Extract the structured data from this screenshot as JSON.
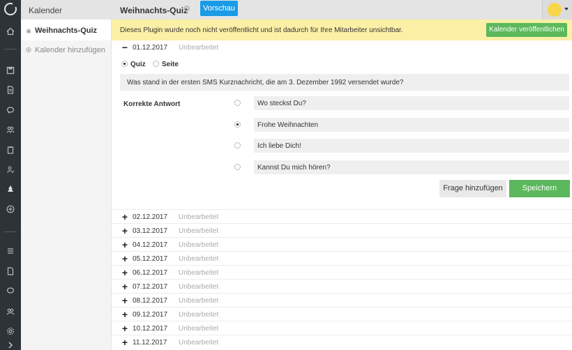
{
  "rail": {
    "icons": [
      "home-icon",
      "save-icon",
      "document-icon",
      "chat-icon",
      "group-icon",
      "clipboard-icon",
      "users-edit-icon",
      "tree-icon",
      "plus-circle-icon",
      "menu-icon",
      "page-icon",
      "comments-icon",
      "team-icon",
      "settings-icon",
      "expand-icon"
    ]
  },
  "sidebar": {
    "header": "Kalender",
    "items": [
      {
        "label": "Weihnachts-Quiz",
        "icon": "lock-icon"
      },
      {
        "label": "Kalender hinzufügen",
        "icon": "add-circle-icon"
      }
    ]
  },
  "topbar": {
    "title": "Weihnachts-Quiz",
    "preview_label": "Vorschau"
  },
  "notice": {
    "message": "Dieses Plugin wurde noch nicht veröffentlicht und ist dadurch für Ihre Mitarbeiter unsichtbar.",
    "publish_label": "Kalender veröffentlichen"
  },
  "open_day": {
    "sign": "−",
    "date": "01.12.2017",
    "status": "Unbearbeitet",
    "type_options": [
      "Quiz",
      "Seite"
    ],
    "selected_type": "Quiz",
    "question": "Was stand in der ersten SMS Kurznachricht, die am 3. Dezember 1992 versendet wurde?",
    "answers_label": "Korrekte Antwort",
    "answers": [
      "Wo steckst Du?",
      "Frohe Weihnachten",
      "Ich liebe Dich!",
      "Kannst Du mich hören?"
    ],
    "correct_index": 1,
    "add_question_label": "Frage hinzufügen",
    "save_label": "Speichern"
  },
  "days": [
    {
      "sign": "+",
      "date": "02.12.2017",
      "status": "Unbearbeitet"
    },
    {
      "sign": "+",
      "date": "03.12.2017",
      "status": "Unbearbeitet"
    },
    {
      "sign": "+",
      "date": "04.12.2017",
      "status": "Unbearbeitet"
    },
    {
      "sign": "+",
      "date": "05.12.2017",
      "status": "Unbearbeitet"
    },
    {
      "sign": "+",
      "date": "06.12.2017",
      "status": "Unbearbeitet"
    },
    {
      "sign": "+",
      "date": "07.12.2017",
      "status": "Unbearbeitet"
    },
    {
      "sign": "+",
      "date": "08.12.2017",
      "status": "Unbearbeitet"
    },
    {
      "sign": "+",
      "date": "09.12.2017",
      "status": "Unbearbeitet"
    },
    {
      "sign": "+",
      "date": "10.12.2017",
      "status": "Unbearbeitet"
    },
    {
      "sign": "+",
      "date": "11.12.2017",
      "status": "Unbearbeitet"
    }
  ],
  "colors": {
    "accent_blue": "#1a9be6",
    "publish_green": "#5cb85c",
    "notice_yellow": "#fcf0a6",
    "rail_dark": "#2e3338"
  }
}
